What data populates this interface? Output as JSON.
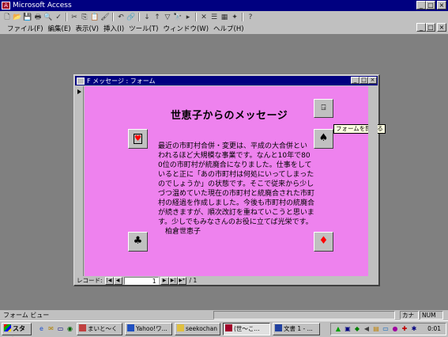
{
  "app": {
    "title": "Microsoft Access",
    "icon_label": "A"
  },
  "window_buttons": {
    "minimize": "_",
    "maximize": "□",
    "close": "×"
  },
  "toolbar": {
    "icons": [
      "new-icon",
      "open-icon",
      "save-icon",
      "print-icon",
      "print-preview-icon",
      "spelling-icon",
      "cut-icon",
      "copy-icon",
      "paste-icon",
      "format-painter-icon",
      "undo-icon",
      "insert-hyperlink-icon",
      "sort-ascending-icon",
      "sort-descending-icon",
      "filter-icon",
      "find-icon",
      "new-record-icon",
      "delete-record-icon",
      "properties-icon",
      "database-window-icon",
      "new-object-icon",
      "help-icon"
    ],
    "glyphs": [
      "🗋",
      "📂",
      "💾",
      "🖶",
      "🔍",
      "✓",
      "✂",
      "⎘",
      "📋",
      "🖌",
      "↶",
      "🔗",
      "↓",
      "↑",
      "▽",
      "🔭",
      "▸",
      "✕",
      "☰",
      "▦",
      "✦",
      "?"
    ]
  },
  "menu": {
    "items": [
      "ファイル(F)",
      "編集(E)",
      "表示(V)",
      "挿入(I)",
      "ツール(T)",
      "ウィンドウ(W)",
      "ヘルプ(H)"
    ]
  },
  "form_window": {
    "title": "F メッセージ : フォーム",
    "heading": "世恵子からのメッセージ",
    "message": "最近の市町村合併・変更は、平成の大合併といわれるほど大規模な事業です。なんと10年で800位の市町村が統廃合になりました。仕事をしていると正に「あの市町村は何処にいってしまったのでしょうか」の状態です。そこで従来から少しづつ温めていた現在の市町村と統廃合された市町村の経過を作成しました。今後も市町村の統廃合が続きますが、順次改訂を重ねていこうと思います。少しでもみなさんのお役に立てば光栄です。\n　柏倉世恵子",
    "suit_buttons": {
      "heart": "♥",
      "spade": "♠",
      "club": "♣",
      "diamond": "♦"
    },
    "close_form_icon": "⍈",
    "tooltip": "フォームを閉じる",
    "navigation": {
      "label": "レコード:",
      "first": "|◀",
      "prev": "◀",
      "current": "1",
      "next": "▶",
      "last": "▶|",
      "new": "▶*",
      "total": "/ 1"
    }
  },
  "colors": {
    "desktop": "#808080",
    "form_background": "#ee82ee",
    "titlebar": "#000080",
    "heart": "#ff0000",
    "diamond": "#ff0000"
  },
  "statusbar": {
    "text": "フォーム ビュー",
    "indicators": [
      "カナ",
      "NUM"
    ]
  },
  "taskbar": {
    "start_label": "スタート",
    "quicklaunch_icons": [
      "ie-icon",
      "outlook-icon",
      "desktop-icon",
      "channel-icon"
    ],
    "tasks": [
      "まいと〜く",
      "Yahoo!ワ...",
      "seekochan",
      "(世〜こ...",
      "文書 1 - ..."
    ],
    "clock": "0:01"
  }
}
